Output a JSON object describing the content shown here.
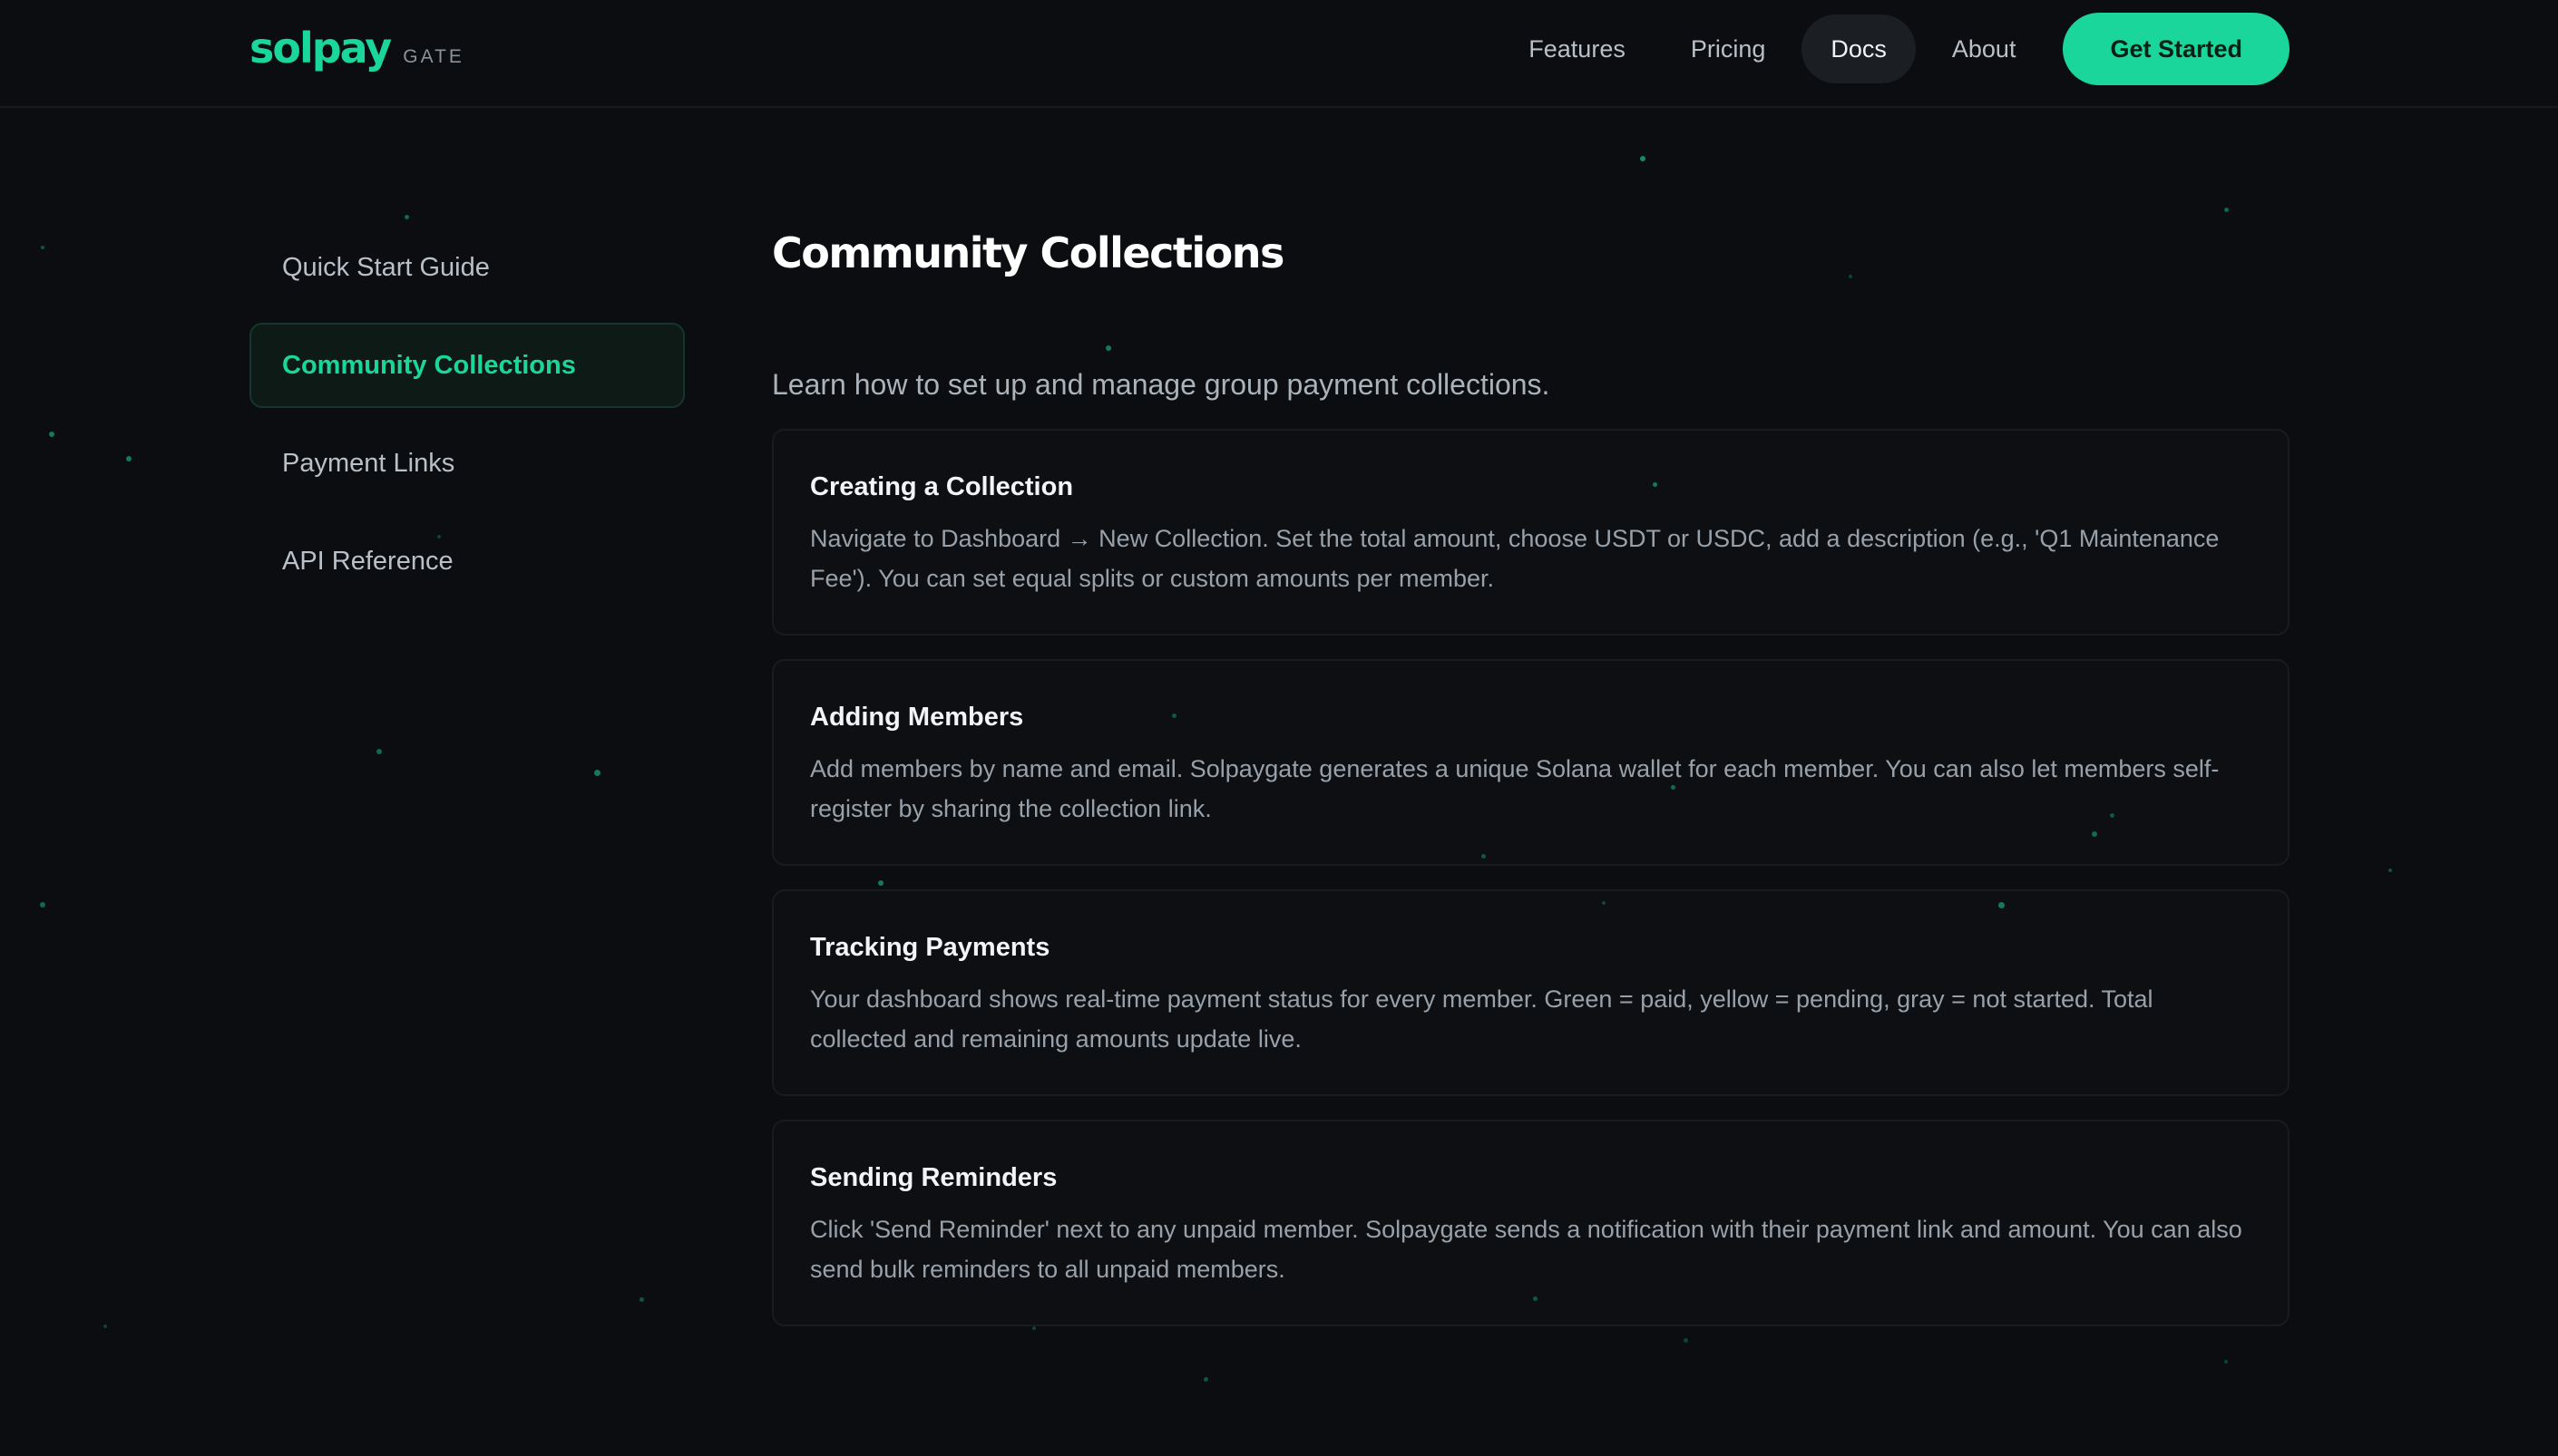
{
  "header": {
    "logo_main": "solpay",
    "logo_sub": "GATE",
    "nav": [
      "Features",
      "Pricing",
      "Docs",
      "About"
    ],
    "active_nav": "Docs",
    "cta_label": "Get Started"
  },
  "sidebar": {
    "items": [
      {
        "label": "Quick Start Guide",
        "active": false
      },
      {
        "label": "Community Collections",
        "active": true
      },
      {
        "label": "Payment Links",
        "active": false
      },
      {
        "label": "API Reference",
        "active": false
      }
    ]
  },
  "main": {
    "title": "Community Collections",
    "subtitle": "Learn how to set up and manage group payment collections.",
    "cards": [
      {
        "title": "Creating a Collection",
        "body": "Navigate to Dashboard → New Collection. Set the total amount, choose USDT or USDC, add a description (e.g., 'Q1 Maintenance Fee'). You can set equal splits or custom amounts per member."
      },
      {
        "title": "Adding Members",
        "body": "Add members by name and email. Solpaygate generates a unique Solana wallet for each member. You can also let members self-register by sharing the collection link."
      },
      {
        "title": "Tracking Payments",
        "body": "Your dashboard shows real-time payment status for every member. Green = paid, yellow = pending, gray = not started. Total collected and remaining amounts update live."
      },
      {
        "title": "Sending Reminders",
        "body": "Click 'Send Reminder' next to any unpaid member. Solpaygate sends a notification with their payment link and amount. You can also send bulk reminders to all unpaid members."
      }
    ]
  },
  "colors": {
    "accent": "#1bd69a",
    "background": "#0b0d10"
  }
}
